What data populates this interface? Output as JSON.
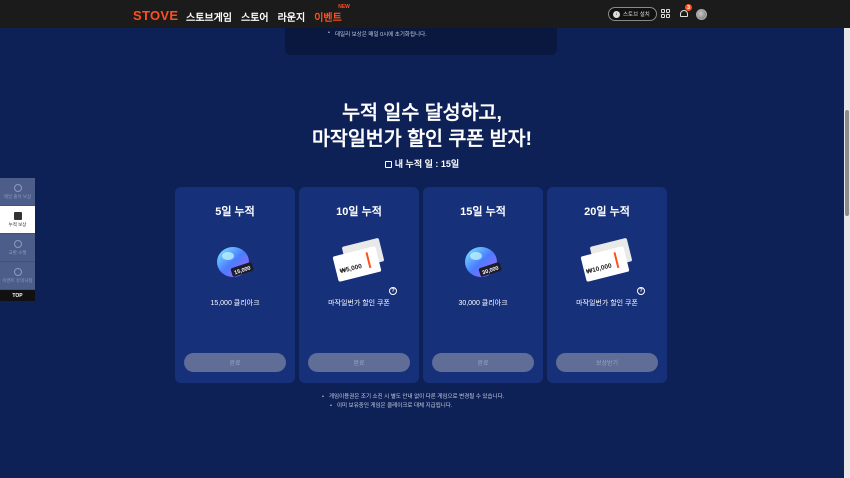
{
  "header": {
    "logo": "STOVE",
    "nav": [
      "스토브게임",
      "스토어",
      "라운지"
    ],
    "event_label": "이벤트",
    "event_badge": "NEW",
    "install_label": "스토브 설치",
    "notification_count": "3"
  },
  "notice": {
    "line": "데일리 보상은 매일 0시에 초기화됩니다."
  },
  "hero": {
    "title_line1": "누적 일수 달성하고,",
    "title_line2": "마작일번가 할인 쿠폰 받자!",
    "days_label": "내 누적 일 : 15일"
  },
  "cards": [
    {
      "title": "5일 누적",
      "reward": "15,000 클리아크",
      "amount_tag": "15,000",
      "button": "완료",
      "type": "gem"
    },
    {
      "title": "10일 누적",
      "reward": "마작일번가 할인 쿠폰",
      "amount_tag": "₩5,000",
      "button": "완료",
      "type": "coupon"
    },
    {
      "title": "15일 누적",
      "reward": "30,000 클리아크",
      "amount_tag": "30,000",
      "button": "완료",
      "type": "gem"
    },
    {
      "title": "20일 누적",
      "reward": "마작일번가 할인 쿠폰",
      "amount_tag": "₩10,000",
      "button": "보상받기",
      "type": "coupon"
    }
  ],
  "sidenav": {
    "items": [
      "매일 출석 보상",
      "누적 보상",
      "교환 소켓",
      "이벤트 유의사항"
    ],
    "top": "TOP"
  },
  "footnotes": [
    "게임이용권은 조기 소진 시 별도 안내 없이 다른 게임으로 변경될 수 있습니다.",
    "이미 보유중인 게임은 클레이크로 대체 지급됩니다."
  ],
  "colors": {
    "background": "#0e2156",
    "card": "#16307a",
    "accent": "#ff4f1f",
    "button_disabled": "#5f6d97"
  }
}
